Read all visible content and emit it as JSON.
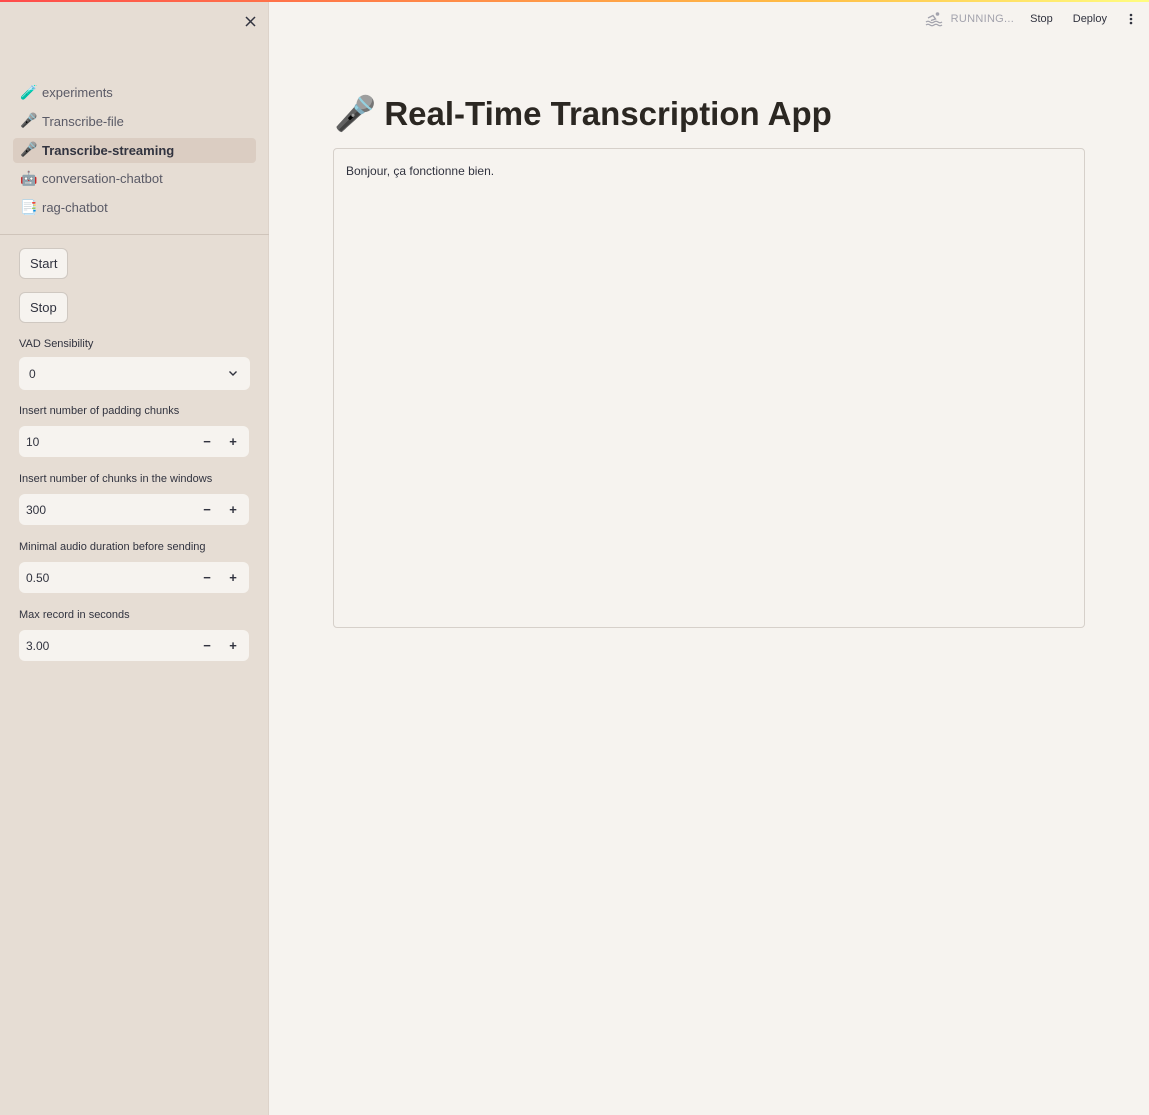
{
  "sidebar": {
    "nav": [
      {
        "emoji": "🧪",
        "label": "experiments",
        "active": false
      },
      {
        "emoji": "🎤",
        "label": "Transcribe-file",
        "active": false
      },
      {
        "emoji": "🎤",
        "label": "Transcribe-streaming",
        "active": true
      },
      {
        "emoji": "🤖",
        "label": "conversation-chatbot",
        "active": false
      },
      {
        "emoji": "📑",
        "label": "rag-chatbot",
        "active": false
      }
    ],
    "start_label": "Start",
    "stop_label": "Stop",
    "vad": {
      "label": "VAD Sensibility",
      "value": "0"
    },
    "padding_chunks": {
      "label": "Insert number of padding chunks",
      "value": "10"
    },
    "window_chunks": {
      "label": "Insert number of chunks in the windows",
      "value": "300"
    },
    "min_duration": {
      "label": "Minimal audio duration before sending",
      "value": "0.50"
    },
    "max_record": {
      "label": "Max record in seconds",
      "value": "3.00"
    },
    "minus": "−",
    "plus": "+"
  },
  "header": {
    "status": "RUNNING...",
    "stop_label": "Stop",
    "deploy_label": "Deploy"
  },
  "main": {
    "title_emoji": "🎤",
    "title": "Real-Time Transcription App",
    "transcript": "Bonjour, ça fonctionne bien."
  },
  "colors": {
    "sidebar_bg": "#e6ddd4",
    "main_bg": "#f6f3ef",
    "active_item_bg": "#dbcdc2",
    "text": "#31333f"
  }
}
